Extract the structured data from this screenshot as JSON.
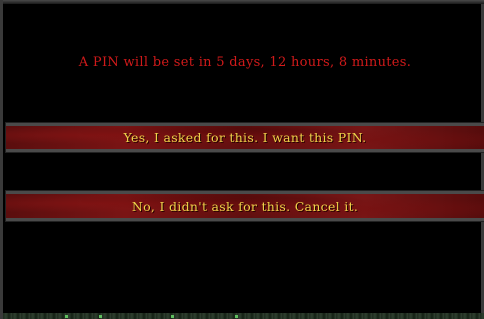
{
  "dialog": {
    "message": "A PIN will be set in 5 days, 12 hours, 8 minutes.",
    "confirm_label": "Yes, I asked for this. I want this PIN.",
    "cancel_label": "No, I didn't ask for this. Cancel it."
  },
  "colors": {
    "message_text": "#d11a1a",
    "button_text": "#f0d24a",
    "button_background": "#6a1212",
    "frame": "#3a3a3a",
    "background": "#000000"
  }
}
